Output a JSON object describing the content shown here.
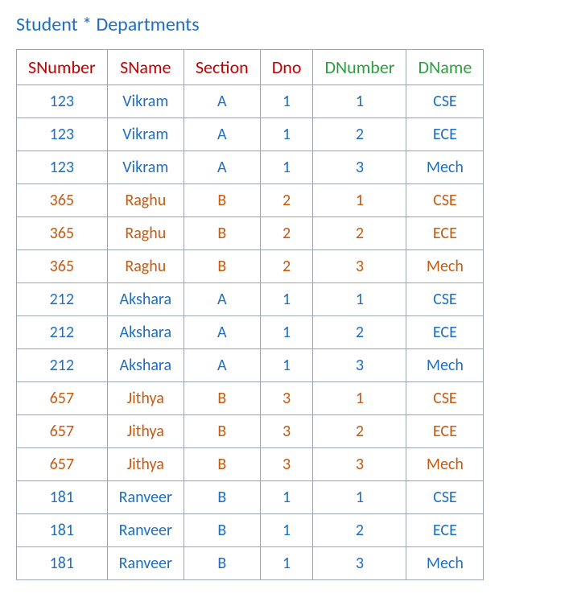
{
  "title": "Student * Departments",
  "headers": [
    {
      "label": "SNumber",
      "color": "red"
    },
    {
      "label": "SName",
      "color": "red"
    },
    {
      "label": "Section",
      "color": "red"
    },
    {
      "label": "Dno",
      "color": "red"
    },
    {
      "label": "DNumber",
      "color": "green"
    },
    {
      "label": "DName",
      "color": "green"
    }
  ],
  "rows": [
    {
      "color": "blue",
      "cells": [
        "123",
        "Vikram",
        "A",
        "1",
        "1",
        "CSE"
      ]
    },
    {
      "color": "blue",
      "cells": [
        "123",
        "Vikram",
        "A",
        "1",
        "2",
        "ECE"
      ]
    },
    {
      "color": "blue",
      "cells": [
        "123",
        "Vikram",
        "A",
        "1",
        "3",
        "Mech"
      ]
    },
    {
      "color": "orange",
      "cells": [
        "365",
        "Raghu",
        "B",
        "2",
        "1",
        "CSE"
      ]
    },
    {
      "color": "orange",
      "cells": [
        "365",
        "Raghu",
        "B",
        "2",
        "2",
        "ECE"
      ]
    },
    {
      "color": "orange",
      "cells": [
        "365",
        "Raghu",
        "B",
        "2",
        "3",
        "Mech"
      ]
    },
    {
      "color": "blue",
      "cells": [
        "212",
        "Akshara",
        "A",
        "1",
        "1",
        "CSE"
      ]
    },
    {
      "color": "blue",
      "cells": [
        "212",
        "Akshara",
        "A",
        "1",
        "2",
        "ECE"
      ]
    },
    {
      "color": "blue",
      "cells": [
        "212",
        "Akshara",
        "A",
        "1",
        "3",
        "Mech"
      ]
    },
    {
      "color": "orange",
      "cells": [
        "657",
        "Jithya",
        "B",
        "3",
        "1",
        "CSE"
      ]
    },
    {
      "color": "orange",
      "cells": [
        "657",
        "Jithya",
        "B",
        "3",
        "2",
        "ECE"
      ]
    },
    {
      "color": "orange",
      "cells": [
        "657",
        "Jithya",
        "B",
        "3",
        "3",
        "Mech"
      ]
    },
    {
      "color": "blue",
      "cells": [
        "181",
        "Ranveer",
        "B",
        "1",
        "1",
        "CSE"
      ]
    },
    {
      "color": "blue",
      "cells": [
        "181",
        "Ranveer",
        "B",
        "1",
        "2",
        "ECE"
      ]
    },
    {
      "color": "blue",
      "cells": [
        "181",
        "Ranveer",
        "B",
        "1",
        "3",
        "Mech"
      ]
    }
  ]
}
